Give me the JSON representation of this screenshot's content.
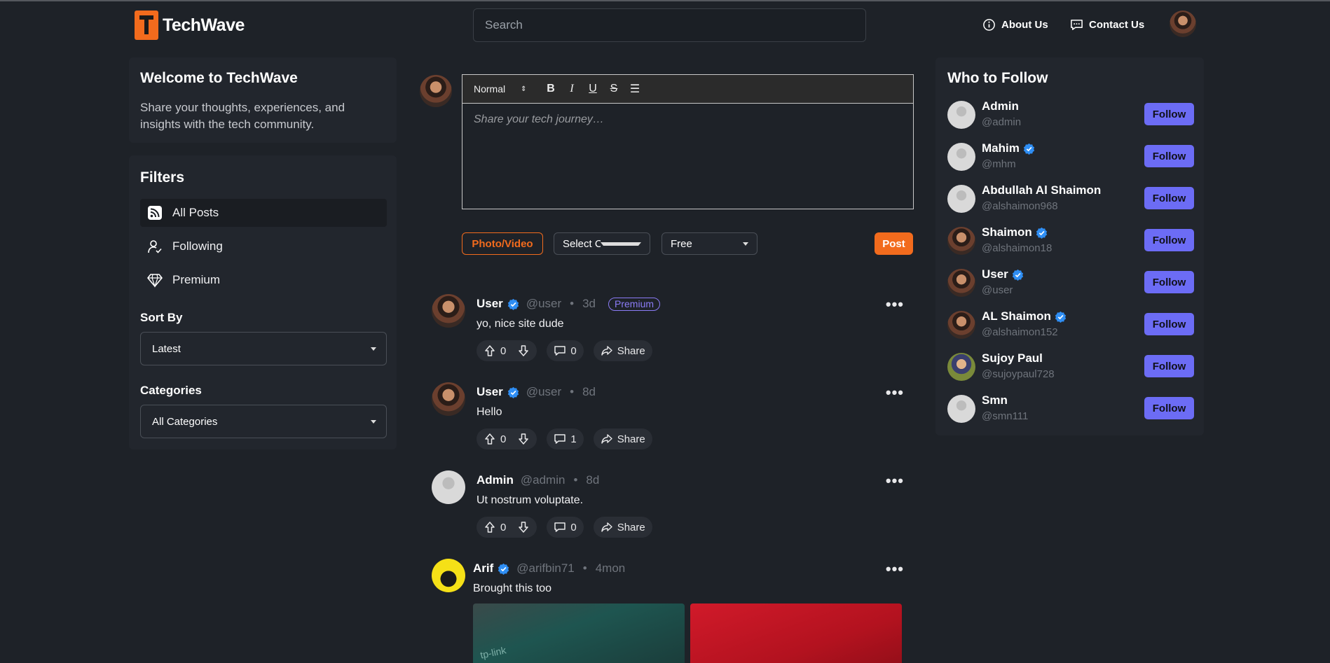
{
  "brand": {
    "name": "TechWave",
    "accent": "#f26b1d"
  },
  "search": {
    "placeholder": "Search"
  },
  "nav": {
    "about": "About Us",
    "contact": "Contact Us"
  },
  "welcome": {
    "title": "Welcome to TechWave",
    "text": "Share your thoughts, experiences, and insights with the tech community."
  },
  "filters": {
    "title": "Filters",
    "items": [
      {
        "label": "All Posts",
        "icon": "rss-icon",
        "active": true
      },
      {
        "label": "Following",
        "icon": "user-check-icon",
        "active": false
      },
      {
        "label": "Premium",
        "icon": "diamond-icon",
        "active": false
      }
    ],
    "sort_label": "Sort By",
    "sort_value": "Latest",
    "categories_label": "Categories",
    "categories_value": "All Categories"
  },
  "composer": {
    "format": "Normal",
    "placeholder": "Share your tech journey…",
    "photo_label": "Photo/Video",
    "category_label": "Select Category",
    "price_label": "Free",
    "post_label": "Post"
  },
  "posts": [
    {
      "name": "User",
      "handle": "@user",
      "time": "3d",
      "badge": "Premium",
      "text": "yo, nice site dude",
      "up": "0",
      "comments": "0",
      "share": "Share"
    },
    {
      "name": "User",
      "handle": "@user",
      "time": "8d",
      "text": "Hello",
      "up": "0",
      "comments": "1",
      "share": "Share"
    },
    {
      "name": "Admin",
      "handle": "@admin",
      "time": "8d",
      "text": "Ut nostrum voluptate.",
      "up": "0",
      "comments": "0",
      "share": "Share"
    },
    {
      "name": "Arif",
      "handle": "@arifbin71",
      "time": "4mon",
      "text": "Brought this too",
      "image_text": "tp-link"
    }
  ],
  "follow": {
    "title": "Who to Follow",
    "button": "Follow",
    "users": [
      {
        "name": "Admin",
        "handle": "@admin",
        "verified": false
      },
      {
        "name": "Mahim",
        "handle": "@mhm",
        "verified": true
      },
      {
        "name": "Abdullah Al Shaimon",
        "handle": "@alshaimon968",
        "verified": false
      },
      {
        "name": "Shaimon",
        "handle": "@alshaimon18",
        "verified": true
      },
      {
        "name": "User",
        "handle": "@user",
        "verified": true
      },
      {
        "name": "AL Shaimon",
        "handle": "@alshaimon152",
        "verified": true
      },
      {
        "name": "Sujoy Paul",
        "handle": "@sujoypaul728",
        "verified": false
      },
      {
        "name": "Smn",
        "handle": "@smn111",
        "verified": false
      }
    ]
  }
}
